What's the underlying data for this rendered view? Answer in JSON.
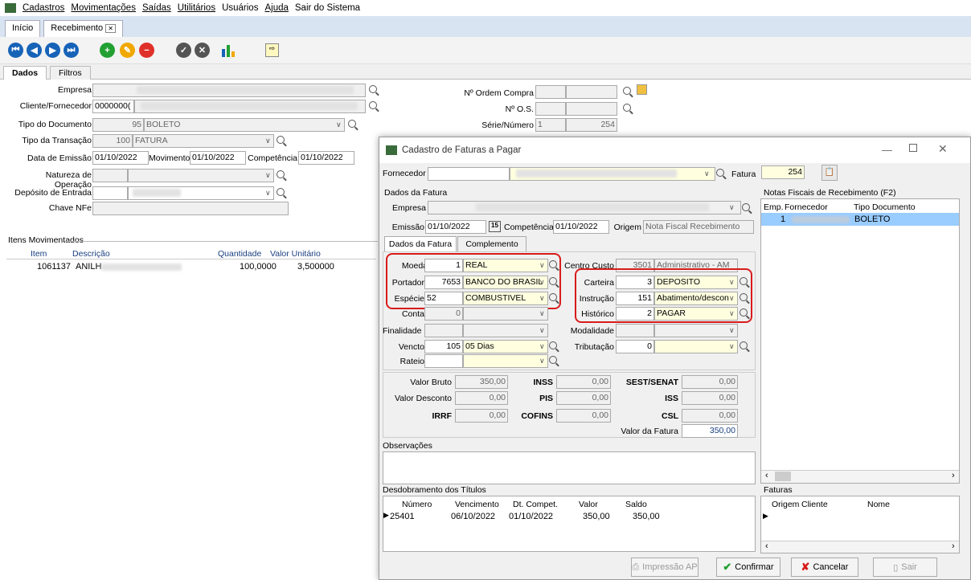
{
  "menu": {
    "items": [
      "Cadastros",
      "Movimentações",
      "Saídas",
      "Utilitários",
      "Usuários",
      "Ajuda",
      "Sair do Sistema"
    ]
  },
  "tabs": {
    "home": "Início",
    "recebimento": "Recebimento"
  },
  "subtabs": {
    "dados": "Dados",
    "filtros": "Filtros"
  },
  "form": {
    "empresa_label": "Empresa",
    "cliente_label": "Cliente/Fornecedor",
    "cliente_value": "0000000(",
    "tipo_doc_label": "Tipo do Documento",
    "tipo_doc_code": "95",
    "tipo_doc_value": "BOLETO",
    "tipo_trans_label": "Tipo da Transação",
    "tipo_trans_code": "100",
    "tipo_trans_value": "FATURA",
    "data_emissao_label": "Data de Emissão",
    "data_emissao": "01/10/2022",
    "movimento_label": "Movimento",
    "movimento": "01/10/2022",
    "competencia_label": "Competência",
    "competencia": "01/10/2022",
    "natureza_label": "Natureza de Operação",
    "deposito_label": "Depósito de Entrada",
    "chave_label": "Chave NFe",
    "ordem_compra_label": "Nº Ordem Compra",
    "os_label": "Nº O.S.",
    "serie_label": "Série/Número",
    "serie_value": "1",
    "numero_value": "254"
  },
  "items": {
    "title": "Itens Movimentados",
    "columns": [
      "Item",
      "Descrição",
      "Quantidade",
      "Valor Unitário"
    ],
    "rows": [
      {
        "item": "1061137",
        "desc": "ANILH",
        "qtd": "100,0000",
        "valor": "3,500000"
      }
    ]
  },
  "dialog": {
    "title": "Cadastro de Faturas a Pagar",
    "fornecedor_label": "Fornecedor",
    "fatura_label": "Fatura",
    "fatura_value": "254",
    "dados_fatura": "Dados da Fatura",
    "empresa_label": "Empresa",
    "emissao_label": "Emissão",
    "emissao": "01/10/2022",
    "cal": "15",
    "competencia_label": "Competência",
    "competencia": "01/10/2022",
    "origem_label": "Origem",
    "origem": "Nota Fiscal Recebimento",
    "tab_dados": "Dados da Fatura",
    "tab_complemento": "Complemento",
    "moeda_label": "Moeda",
    "moeda_code": "1",
    "moeda": "REAL",
    "portador_label": "Portador",
    "portador_code": "7653",
    "portador": "BANCO DO BRASIL",
    "especie_label": "Espécie",
    "especie_code": "52",
    "especie": "COMBUSTIVEL",
    "conta_label": "Conta",
    "conta_code": "0",
    "finalidade_label": "Finalidade",
    "vencto_label": "Vencto",
    "vencto_code": "105",
    "vencto": "05 Dias",
    "rateio_label": "Rateio",
    "centro_custo_label": "Centro Custo",
    "centro_custo_code": "3501",
    "centro_custo": "Administrativo - AM",
    "carteira_label": "Carteira",
    "carteira_code": "3",
    "carteira": "DEPOSITO",
    "instrucao_label": "Instrução",
    "instrucao_code": "151",
    "instrucao": "Abatimento/descon",
    "historico_label": "Histórico",
    "historico_code": "2",
    "historico": "PAGAR",
    "modalidade_label": "Modalidade",
    "tributacao_label": "Tributação",
    "tributacao_code": "0",
    "valor_bruto_label": "Valor Bruto",
    "valor_bruto": "350,00",
    "valor_desconto_label": "Valor Desconto",
    "valor_desconto": "0,00",
    "irrf_label": "IRRF",
    "irrf": "0,00",
    "inss_label": "INSS",
    "inss": "0,00",
    "pis_label": "PIS",
    "pis": "0,00",
    "cofins_label": "COFINS",
    "cofins": "0,00",
    "sest_label": "SEST/SENAT",
    "sest": "0,00",
    "iss_label": "ISS",
    "iss": "0,00",
    "csl_label": "CSL",
    "csl": "0,00",
    "valor_fatura_label": "Valor da Fatura",
    "valor_fatura": "350,00",
    "observacoes_label": "Observações",
    "desdobramento_label": "Desdobramento dos Títulos",
    "desd_columns": [
      "Número",
      "Vencimento",
      "Dt. Compet.",
      "Valor",
      "Saldo"
    ],
    "desd_row": {
      "numero": "25401",
      "vencimento": "06/10/2022",
      "compet": "01/10/2022",
      "valor": "350,00",
      "saldo": "350,00"
    },
    "notas_label": "Notas Fiscais de Recebimento  (F2)",
    "notas_columns": [
      "Emp.",
      "Fornecedor",
      "Tipo Documento"
    ],
    "notas_row": {
      "emp": "1",
      "tipo": "BOLETO"
    },
    "faturas_label": "Faturas",
    "faturas_columns": [
      "Origem",
      "Cliente",
      "Nome"
    ],
    "btn_impressao": "Impressão AP",
    "btn_confirmar": "Confirmar",
    "btn_cancelar": "Cancelar",
    "btn_sair": "Sair"
  }
}
